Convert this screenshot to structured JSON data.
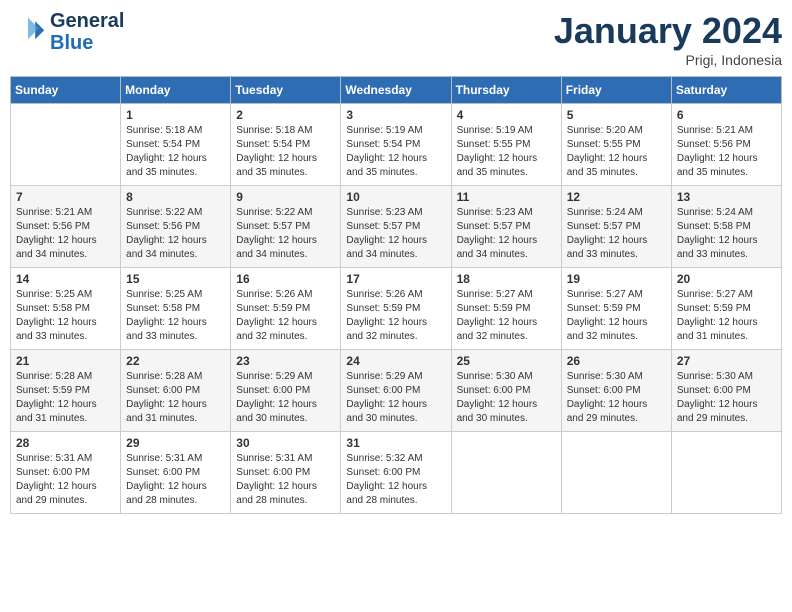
{
  "header": {
    "logo_line1": "General",
    "logo_line2": "Blue",
    "month": "January 2024",
    "location": "Prigi, Indonesia"
  },
  "days_of_week": [
    "Sunday",
    "Monday",
    "Tuesday",
    "Wednesday",
    "Thursday",
    "Friday",
    "Saturday"
  ],
  "weeks": [
    [
      {
        "day": "",
        "info": ""
      },
      {
        "day": "1",
        "info": "Sunrise: 5:18 AM\nSunset: 5:54 PM\nDaylight: 12 hours\nand 35 minutes."
      },
      {
        "day": "2",
        "info": "Sunrise: 5:18 AM\nSunset: 5:54 PM\nDaylight: 12 hours\nand 35 minutes."
      },
      {
        "day": "3",
        "info": "Sunrise: 5:19 AM\nSunset: 5:54 PM\nDaylight: 12 hours\nand 35 minutes."
      },
      {
        "day": "4",
        "info": "Sunrise: 5:19 AM\nSunset: 5:55 PM\nDaylight: 12 hours\nand 35 minutes."
      },
      {
        "day": "5",
        "info": "Sunrise: 5:20 AM\nSunset: 5:55 PM\nDaylight: 12 hours\nand 35 minutes."
      },
      {
        "day": "6",
        "info": "Sunrise: 5:21 AM\nSunset: 5:56 PM\nDaylight: 12 hours\nand 35 minutes."
      }
    ],
    [
      {
        "day": "7",
        "info": "Sunrise: 5:21 AM\nSunset: 5:56 PM\nDaylight: 12 hours\nand 34 minutes."
      },
      {
        "day": "8",
        "info": "Sunrise: 5:22 AM\nSunset: 5:56 PM\nDaylight: 12 hours\nand 34 minutes."
      },
      {
        "day": "9",
        "info": "Sunrise: 5:22 AM\nSunset: 5:57 PM\nDaylight: 12 hours\nand 34 minutes."
      },
      {
        "day": "10",
        "info": "Sunrise: 5:23 AM\nSunset: 5:57 PM\nDaylight: 12 hours\nand 34 minutes."
      },
      {
        "day": "11",
        "info": "Sunrise: 5:23 AM\nSunset: 5:57 PM\nDaylight: 12 hours\nand 34 minutes."
      },
      {
        "day": "12",
        "info": "Sunrise: 5:24 AM\nSunset: 5:57 PM\nDaylight: 12 hours\nand 33 minutes."
      },
      {
        "day": "13",
        "info": "Sunrise: 5:24 AM\nSunset: 5:58 PM\nDaylight: 12 hours\nand 33 minutes."
      }
    ],
    [
      {
        "day": "14",
        "info": "Sunrise: 5:25 AM\nSunset: 5:58 PM\nDaylight: 12 hours\nand 33 minutes."
      },
      {
        "day": "15",
        "info": "Sunrise: 5:25 AM\nSunset: 5:58 PM\nDaylight: 12 hours\nand 33 minutes."
      },
      {
        "day": "16",
        "info": "Sunrise: 5:26 AM\nSunset: 5:59 PM\nDaylight: 12 hours\nand 32 minutes."
      },
      {
        "day": "17",
        "info": "Sunrise: 5:26 AM\nSunset: 5:59 PM\nDaylight: 12 hours\nand 32 minutes."
      },
      {
        "day": "18",
        "info": "Sunrise: 5:27 AM\nSunset: 5:59 PM\nDaylight: 12 hours\nand 32 minutes."
      },
      {
        "day": "19",
        "info": "Sunrise: 5:27 AM\nSunset: 5:59 PM\nDaylight: 12 hours\nand 32 minutes."
      },
      {
        "day": "20",
        "info": "Sunrise: 5:27 AM\nSunset: 5:59 PM\nDaylight: 12 hours\nand 31 minutes."
      }
    ],
    [
      {
        "day": "21",
        "info": "Sunrise: 5:28 AM\nSunset: 5:59 PM\nDaylight: 12 hours\nand 31 minutes."
      },
      {
        "day": "22",
        "info": "Sunrise: 5:28 AM\nSunset: 6:00 PM\nDaylight: 12 hours\nand 31 minutes."
      },
      {
        "day": "23",
        "info": "Sunrise: 5:29 AM\nSunset: 6:00 PM\nDaylight: 12 hours\nand 30 minutes."
      },
      {
        "day": "24",
        "info": "Sunrise: 5:29 AM\nSunset: 6:00 PM\nDaylight: 12 hours\nand 30 minutes."
      },
      {
        "day": "25",
        "info": "Sunrise: 5:30 AM\nSunset: 6:00 PM\nDaylight: 12 hours\nand 30 minutes."
      },
      {
        "day": "26",
        "info": "Sunrise: 5:30 AM\nSunset: 6:00 PM\nDaylight: 12 hours\nand 29 minutes."
      },
      {
        "day": "27",
        "info": "Sunrise: 5:30 AM\nSunset: 6:00 PM\nDaylight: 12 hours\nand 29 minutes."
      }
    ],
    [
      {
        "day": "28",
        "info": "Sunrise: 5:31 AM\nSunset: 6:00 PM\nDaylight: 12 hours\nand 29 minutes."
      },
      {
        "day": "29",
        "info": "Sunrise: 5:31 AM\nSunset: 6:00 PM\nDaylight: 12 hours\nand 28 minutes."
      },
      {
        "day": "30",
        "info": "Sunrise: 5:31 AM\nSunset: 6:00 PM\nDaylight: 12 hours\nand 28 minutes."
      },
      {
        "day": "31",
        "info": "Sunrise: 5:32 AM\nSunset: 6:00 PM\nDaylight: 12 hours\nand 28 minutes."
      },
      {
        "day": "",
        "info": ""
      },
      {
        "day": "",
        "info": ""
      },
      {
        "day": "",
        "info": ""
      }
    ]
  ]
}
